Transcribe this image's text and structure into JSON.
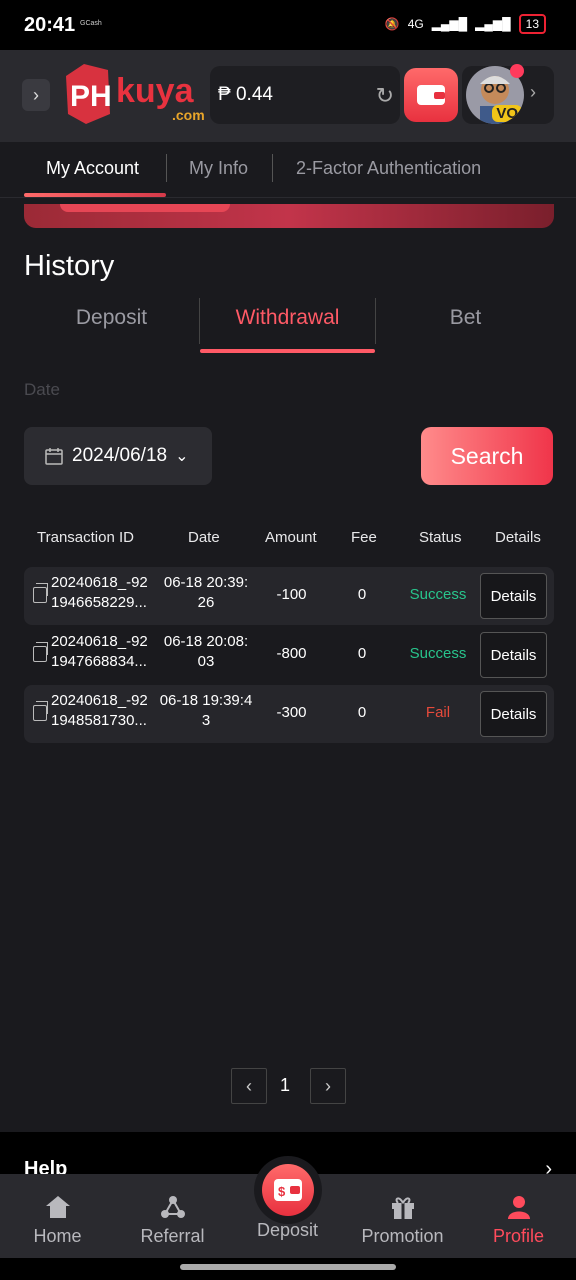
{
  "status_bar": {
    "time": "20:41",
    "app_note": "GCash",
    "battery": "13",
    "network": "4G"
  },
  "header": {
    "logo_text": "PH",
    "logo_brand": "kuya",
    "logo_suffix": ".com",
    "balance": "0.44",
    "balance_symbol": "₱",
    "avatar_badge": "VO"
  },
  "account_tabs": [
    {
      "label": "My Account",
      "active": true
    },
    {
      "label": "My Info",
      "active": false
    },
    {
      "label": "2-Factor Authentication",
      "active": false
    }
  ],
  "history": {
    "title": "History",
    "tabs": [
      {
        "label": "Deposit",
        "active": false
      },
      {
        "label": "Withdrawal",
        "active": true
      },
      {
        "label": "Bet",
        "active": false
      }
    ],
    "date_label": "Date",
    "date_value": "2024/06/18",
    "search_label": "Search"
  },
  "table": {
    "headers": [
      "Transaction ID",
      "Date",
      "Amount",
      "Fee",
      "Status",
      "Details"
    ],
    "rows": [
      {
        "txid_1": "20240618_-92",
        "txid_2": "1946658229...",
        "date_1": "06-18 20:39:",
        "date_2": "26",
        "amount": "-100",
        "fee": "0",
        "status": "Success",
        "details": "Details"
      },
      {
        "txid_1": "20240618_-92",
        "txid_2": "1947668834...",
        "date_1": "06-18 20:08:",
        "date_2": "03",
        "amount": "-800",
        "fee": "0",
        "status": "Success",
        "details": "Details"
      },
      {
        "txid_1": "20240618_-92",
        "txid_2": "1948581730...",
        "date_1": "06-18 19:39:4",
        "date_2": "3",
        "amount": "-300",
        "fee": "0",
        "status": "Fail",
        "details": "Details"
      }
    ]
  },
  "pagination": {
    "current": "1",
    "prev": "‹",
    "next": "›"
  },
  "help": {
    "label": "Help",
    "chevron": "›"
  },
  "bottom_nav": [
    {
      "label": "Home",
      "icon": "home-icon"
    },
    {
      "label": "Referral",
      "icon": "referral-icon"
    },
    {
      "label": "Deposit",
      "icon": "wallet-icon"
    },
    {
      "label": "Promotion",
      "icon": "gift-icon"
    },
    {
      "label": "Profile",
      "icon": "user-icon",
      "active": true
    }
  ],
  "colors": {
    "accent": "#ff5a66",
    "success": "#28c48c",
    "fail": "#e64a3b",
    "background": "#1a1a1e"
  }
}
